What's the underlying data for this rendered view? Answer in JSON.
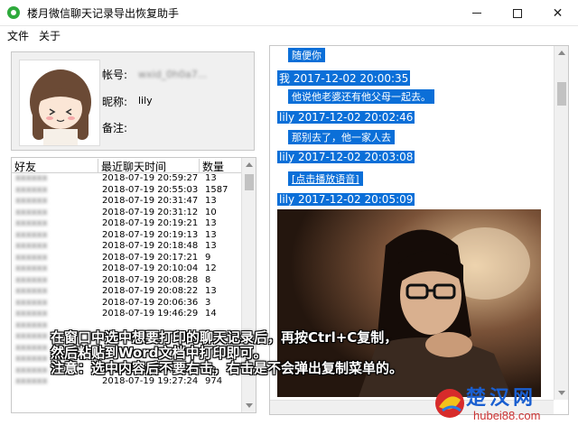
{
  "window": {
    "title": "楼月微信聊天记录导出恢复助手"
  },
  "menu": [
    "文件",
    "关于"
  ],
  "profile": {
    "account_label": "帐号:",
    "account_value": "wxid_0h0a7...",
    "nickname_label": "昵称:",
    "nickname_value": "lily",
    "remark_label": "备注:"
  },
  "friends_table": {
    "columns": [
      "好友",
      "最近聊天时间",
      "数量"
    ],
    "rows": [
      {
        "name": "xxxxxx",
        "time": "2018-07-19 20:59:27",
        "count": "13"
      },
      {
        "name": "xxxxxx",
        "time": "2018-07-19 20:55:03",
        "count": "1587"
      },
      {
        "name": "xxxxxx",
        "time": "2018-07-19 20:31:47",
        "count": "13"
      },
      {
        "name": "xxxxxx",
        "time": "2018-07-19 20:31:12",
        "count": "10"
      },
      {
        "name": "xxxxxx",
        "time": "2018-07-19 20:19:21",
        "count": "13"
      },
      {
        "name": "xxxxxx",
        "time": "2018-07-19 20:19:13",
        "count": "13"
      },
      {
        "name": "xxxxxx",
        "time": "2018-07-19 20:18:48",
        "count": "13"
      },
      {
        "name": "xxxxxx",
        "time": "2018-07-19 20:17:21",
        "count": "9"
      },
      {
        "name": "xxxxxx",
        "time": "2018-07-19 20:10:04",
        "count": "12"
      },
      {
        "name": "xxxxxx",
        "time": "2018-07-19 20:08:28",
        "count": "8"
      },
      {
        "name": "xxxxxx",
        "time": "2018-07-19 20:08:22",
        "count": "13"
      },
      {
        "name": "xxxxxx",
        "time": "2018-07-19 20:06:36",
        "count": "3"
      },
      {
        "name": "xxxxxx",
        "time": "2018-07-19 19:46:29",
        "count": "14"
      },
      {
        "name": "xxxxxx",
        "time": "",
        "count": ""
      },
      {
        "name": "xxxxxx",
        "time": "",
        "count": ""
      },
      {
        "name": "xxxxxx",
        "time": "",
        "count": ""
      },
      {
        "name": "xxxxxx",
        "time": "",
        "count": ""
      },
      {
        "name": "xxxxxx",
        "time": "2018-07-19 19:31:36",
        "count": "13"
      },
      {
        "name": "xxxxxx",
        "time": "2018-07-19 19:27:24",
        "count": "974"
      }
    ]
  },
  "chat": {
    "messages": [
      {
        "kind": "text",
        "text": "随便你"
      },
      {
        "kind": "head",
        "sender": "我",
        "time": "2017-12-02 20:00:35"
      },
      {
        "kind": "text",
        "text": "他说他老婆还有他父母一起去。"
      },
      {
        "kind": "head",
        "sender": "lily",
        "time": "2017-12-02 20:02:46"
      },
      {
        "kind": "text",
        "text": "那别去了，他一家人去"
      },
      {
        "kind": "head",
        "sender": "lily",
        "time": "2017-12-02 20:03:08"
      },
      {
        "kind": "voice",
        "text": "[点击播放语音]"
      },
      {
        "kind": "head",
        "sender": "lily",
        "time": "2017-12-02 20:05:09"
      }
    ]
  },
  "caption": {
    "line1": "在窗口中选中想要打印的聊天记录后，再按Ctrl+C复制，",
    "line2": "然后粘贴到Word文档中打印即可。",
    "line3": "注意：选中内容后不要右击，右击是不会弹出复制菜单的。"
  },
  "watermark": {
    "text": "楚汉网",
    "sub": "hubei88.com"
  },
  "colors": {
    "selection": "#0b6fd8",
    "brand": "#2eaa3c"
  }
}
